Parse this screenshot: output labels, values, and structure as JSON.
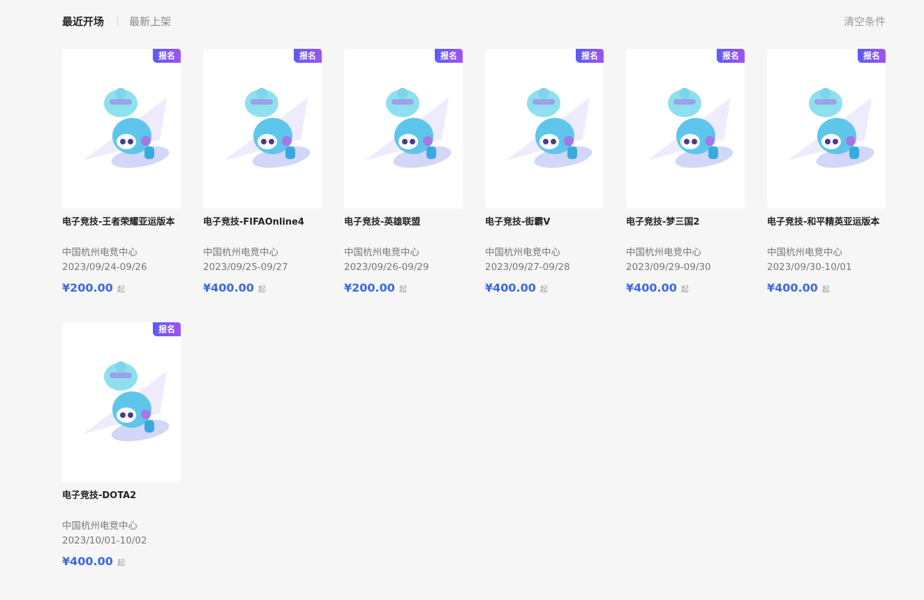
{
  "header": {
    "tab_recent": "最近开场",
    "tab_newest": "最新上架",
    "clear_label": "清空条件"
  },
  "colors": {
    "accent": "#3b67e8",
    "badge_start": "#5b5cf5",
    "badge_end": "#a053f0"
  },
  "events": [
    {
      "badge": "报名",
      "title": "电子竞技-王者荣耀亚运版本",
      "venue": "中国杭州电竞中心",
      "dates": "2023/09/24-09/26",
      "price": "¥200.00",
      "price_suffix": "起",
      "image_icon": "mascot-icon"
    },
    {
      "badge": "报名",
      "title": "电子竞技-FIFAOnline4",
      "venue": "中国杭州电竞中心",
      "dates": "2023/09/25-09/27",
      "price": "¥400.00",
      "price_suffix": "起",
      "image_icon": "mascot-icon"
    },
    {
      "badge": "报名",
      "title": "电子竞技-英雄联盟",
      "venue": "中国杭州电竞中心",
      "dates": "2023/09/26-09/29",
      "price": "¥200.00",
      "price_suffix": "起",
      "image_icon": "mascot-icon"
    },
    {
      "badge": "报名",
      "title": "电子竞技-街霸V",
      "venue": "中国杭州电竞中心",
      "dates": "2023/09/27-09/28",
      "price": "¥400.00",
      "price_suffix": "起",
      "image_icon": "mascot-icon"
    },
    {
      "badge": "报名",
      "title": "电子竞技-梦三国2",
      "venue": "中国杭州电竞中心",
      "dates": "2023/09/29-09/30",
      "price": "¥400.00",
      "price_suffix": "起",
      "image_icon": "mascot-icon"
    },
    {
      "badge": "报名",
      "title": "电子竞技-和平精英亚运版本",
      "venue": "中国杭州电竞中心",
      "dates": "2023/09/30-10/01",
      "price": "¥400.00",
      "price_suffix": "起",
      "image_icon": "mascot-icon"
    },
    {
      "badge": "报名",
      "title": "电子竞技-DOTA2",
      "venue": "中国杭州电竞中心",
      "dates": "2023/10/01-10/02",
      "price": "¥400.00",
      "price_suffix": "起",
      "image_icon": "mascot-icon"
    }
  ]
}
